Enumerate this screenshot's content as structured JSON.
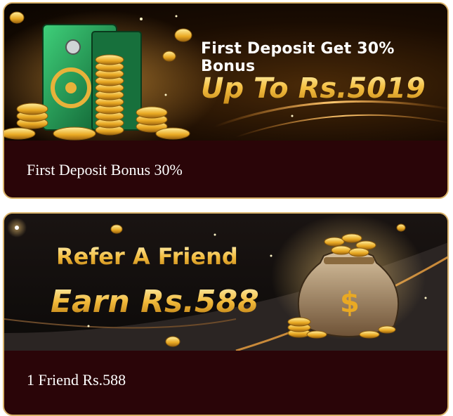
{
  "promotions": [
    {
      "banner_title": "First Deposit Get 30% Bonus",
      "banner_amount": "Up To Rs.5019",
      "caption": "First Deposit Bonus 30%"
    },
    {
      "banner_title": "Refer A Friend",
      "banner_amount": "Earn Rs.588",
      "caption": "1 Friend Rs.588"
    }
  ],
  "colors": {
    "card_background": "#2a0508",
    "card_border": "#d9b36a",
    "gold": "#f5c043",
    "safe_green": "#1f8a4c"
  },
  "icons": [
    "gold-safe-icon",
    "gold-coins-icon",
    "money-bag-icon"
  ]
}
